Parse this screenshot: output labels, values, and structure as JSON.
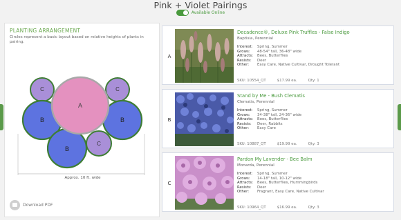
{
  "header": {
    "title": "Pink + Violet Pairings",
    "toggle_label": "Available Online",
    "toggle_on": true
  },
  "colors": {
    "accent": "#4a9a3e",
    "circle_a": "#e491bf",
    "circle_b": "#5d73e0",
    "circle_c": "#a98fd8",
    "ring": "#3e7d34"
  },
  "arrangement": {
    "title": "PLANTING ARRANGEMENT",
    "description": "Circles represent a basic layout based on relative heights of plants in pairing.",
    "circle_labels": {
      "a": "A",
      "b": "B",
      "c": "C"
    },
    "width_label": "Approx. 10 ft. wide",
    "download_label": "Download PDF",
    "download_icon": "pdf-download-icon"
  },
  "plants": [
    {
      "letter": "A",
      "name": "Decadence®, Deluxe Pink Truffles - False Indigo",
      "latin": "Baptisia, Perennial",
      "interest_label": "Interest:",
      "interest": "Spring, Summer",
      "grows_label": "Grows:",
      "grows": "48-54\" tall, 36-48\" wide",
      "attracts_label": "Attracts:",
      "attracts": "Bees, Butterflies",
      "resists_label": "Resists:",
      "resists": "Deer",
      "other_label": "Other:",
      "other": "Easy Care, Native Cultivar, Drought Tolerant",
      "sku": "SKU: 10554_QT",
      "price": "$17.99 ea.",
      "qty": "Qty: 1"
    },
    {
      "letter": "B",
      "name": "Stand by Me - Bush Clematis",
      "latin": "Clematis, Perennial",
      "interest_label": "Interest:",
      "interest": "Spring, Summer",
      "grows_label": "Grows:",
      "grows": "34-38\" tall, 24-36\" wide",
      "attracts_label": "Attracts:",
      "attracts": "Bees, Butterflies",
      "resists_label": "Resists:",
      "resists": "Deer, Rabbits",
      "other_label": "Other:",
      "other": "Easy Care",
      "sku": "SKU: 10887_QT",
      "price": "$19.99 ea.",
      "qty": "Qty: 3"
    },
    {
      "letter": "C",
      "name": "Pardon My Lavender - Bee Balm",
      "latin": "Monarda, Perennial",
      "interest_label": "Interest:",
      "interest": "Spring, Summer",
      "grows_label": "Grows:",
      "grows": "14-18\" tall, 10-12\" wide",
      "attracts_label": "Attracts:",
      "attracts": "Bees, Butterflies, Hummingbirds",
      "resists_label": "Resists:",
      "resists": "Deer",
      "other_label": "Other:",
      "other": "Fragrant, Easy Care, Native Cultivar",
      "sku": "SKU: 10964_QT",
      "price": "$16.99 ea.",
      "qty": "Qty: 3"
    }
  ]
}
